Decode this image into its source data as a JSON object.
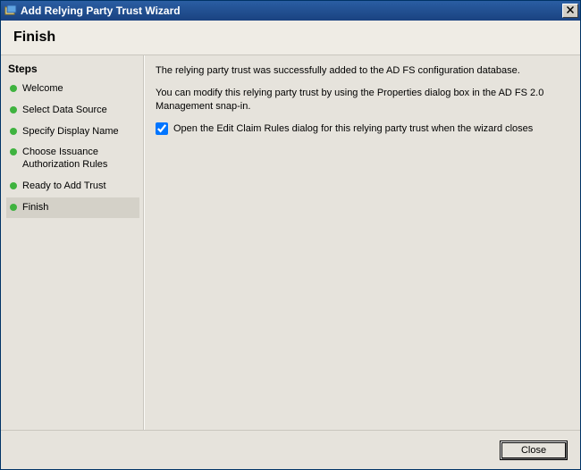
{
  "titlebar": {
    "title": "Add Relying Party Trust Wizard"
  },
  "header": {
    "page_title": "Finish"
  },
  "sidebar": {
    "heading": "Steps",
    "items": [
      {
        "label": "Welcome",
        "active": false
      },
      {
        "label": "Select Data Source",
        "active": false
      },
      {
        "label": "Specify Display Name",
        "active": false
      },
      {
        "label": "Choose Issuance Authorization Rules",
        "active": false
      },
      {
        "label": "Ready to Add Trust",
        "active": false
      },
      {
        "label": "Finish",
        "active": true
      }
    ]
  },
  "content": {
    "para1": "The relying party trust was successfully added to the AD FS configuration database.",
    "para2": "You can modify this relying party trust by using the Properties dialog box in the AD FS 2.0 Management snap-in.",
    "checkbox_label": "Open the Edit Claim Rules dialog for this relying party trust when the wizard closes",
    "checkbox_checked": true
  },
  "footer": {
    "close_label": "Close"
  }
}
